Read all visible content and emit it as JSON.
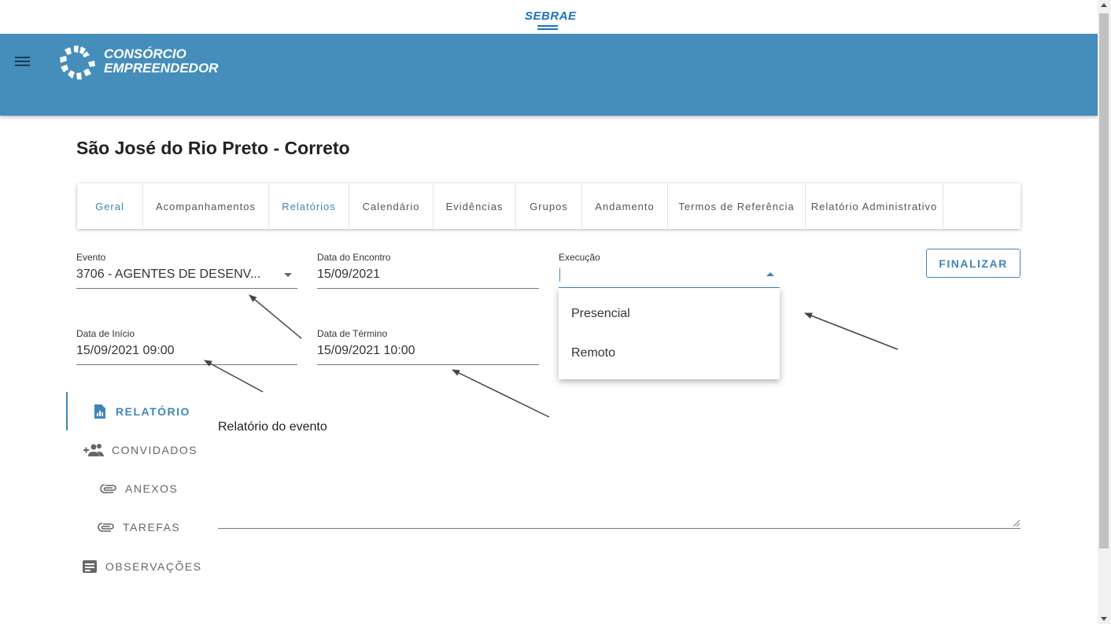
{
  "sebrae": {
    "logo_text": "SEBRAE"
  },
  "header": {
    "brand_line1": "CONSÓRCIO",
    "brand_line2": "EMPREENDEDOR",
    "color": "#458dbb"
  },
  "page": {
    "title": "São José do Rio Preto - Correto"
  },
  "tabs": [
    {
      "label": "Geral",
      "active": true
    },
    {
      "label": "Acompanhamentos",
      "active": false
    },
    {
      "label": "Relatórios",
      "active": true
    },
    {
      "label": "Calendário",
      "active": false
    },
    {
      "label": "Evidências",
      "active": false
    },
    {
      "label": "Grupos",
      "active": false
    },
    {
      "label": "Andamento",
      "active": false
    },
    {
      "label": "Termos de Referência",
      "active": false
    },
    {
      "label": "Relatório Administrativo",
      "active": false
    }
  ],
  "form": {
    "evento": {
      "label": "Evento",
      "value": "3706 - AGENTES DE DESENV..."
    },
    "data_encontro": {
      "label": "Data do Encontro",
      "value": "15/09/2021"
    },
    "execucao": {
      "label": "Execução",
      "value": ""
    },
    "data_inicio": {
      "label": "Data de Início",
      "value": "15/09/2021 09:00"
    },
    "data_termino": {
      "label": "Data de Término",
      "value": "15/09/2021 10:00"
    }
  },
  "finalizar_label": "FINALIZAR",
  "execucao_options": [
    "Presencial",
    "Remoto"
  ],
  "side_nav": [
    {
      "label": "RELATÓRIO",
      "icon": "report-file-icon",
      "active": true
    },
    {
      "label": "CONVIDADOS",
      "icon": "add-group-icon",
      "active": false
    },
    {
      "label": "ANEXOS",
      "icon": "paperclip-icon",
      "active": false
    },
    {
      "label": "TAREFAS",
      "icon": "paperclip-icon",
      "active": false
    },
    {
      "label": "OBSERVAÇÕES",
      "icon": "notes-icon",
      "active": false
    }
  ],
  "report": {
    "label": "Relatório do evento",
    "value": ""
  },
  "accent_color": "#3f86b8"
}
